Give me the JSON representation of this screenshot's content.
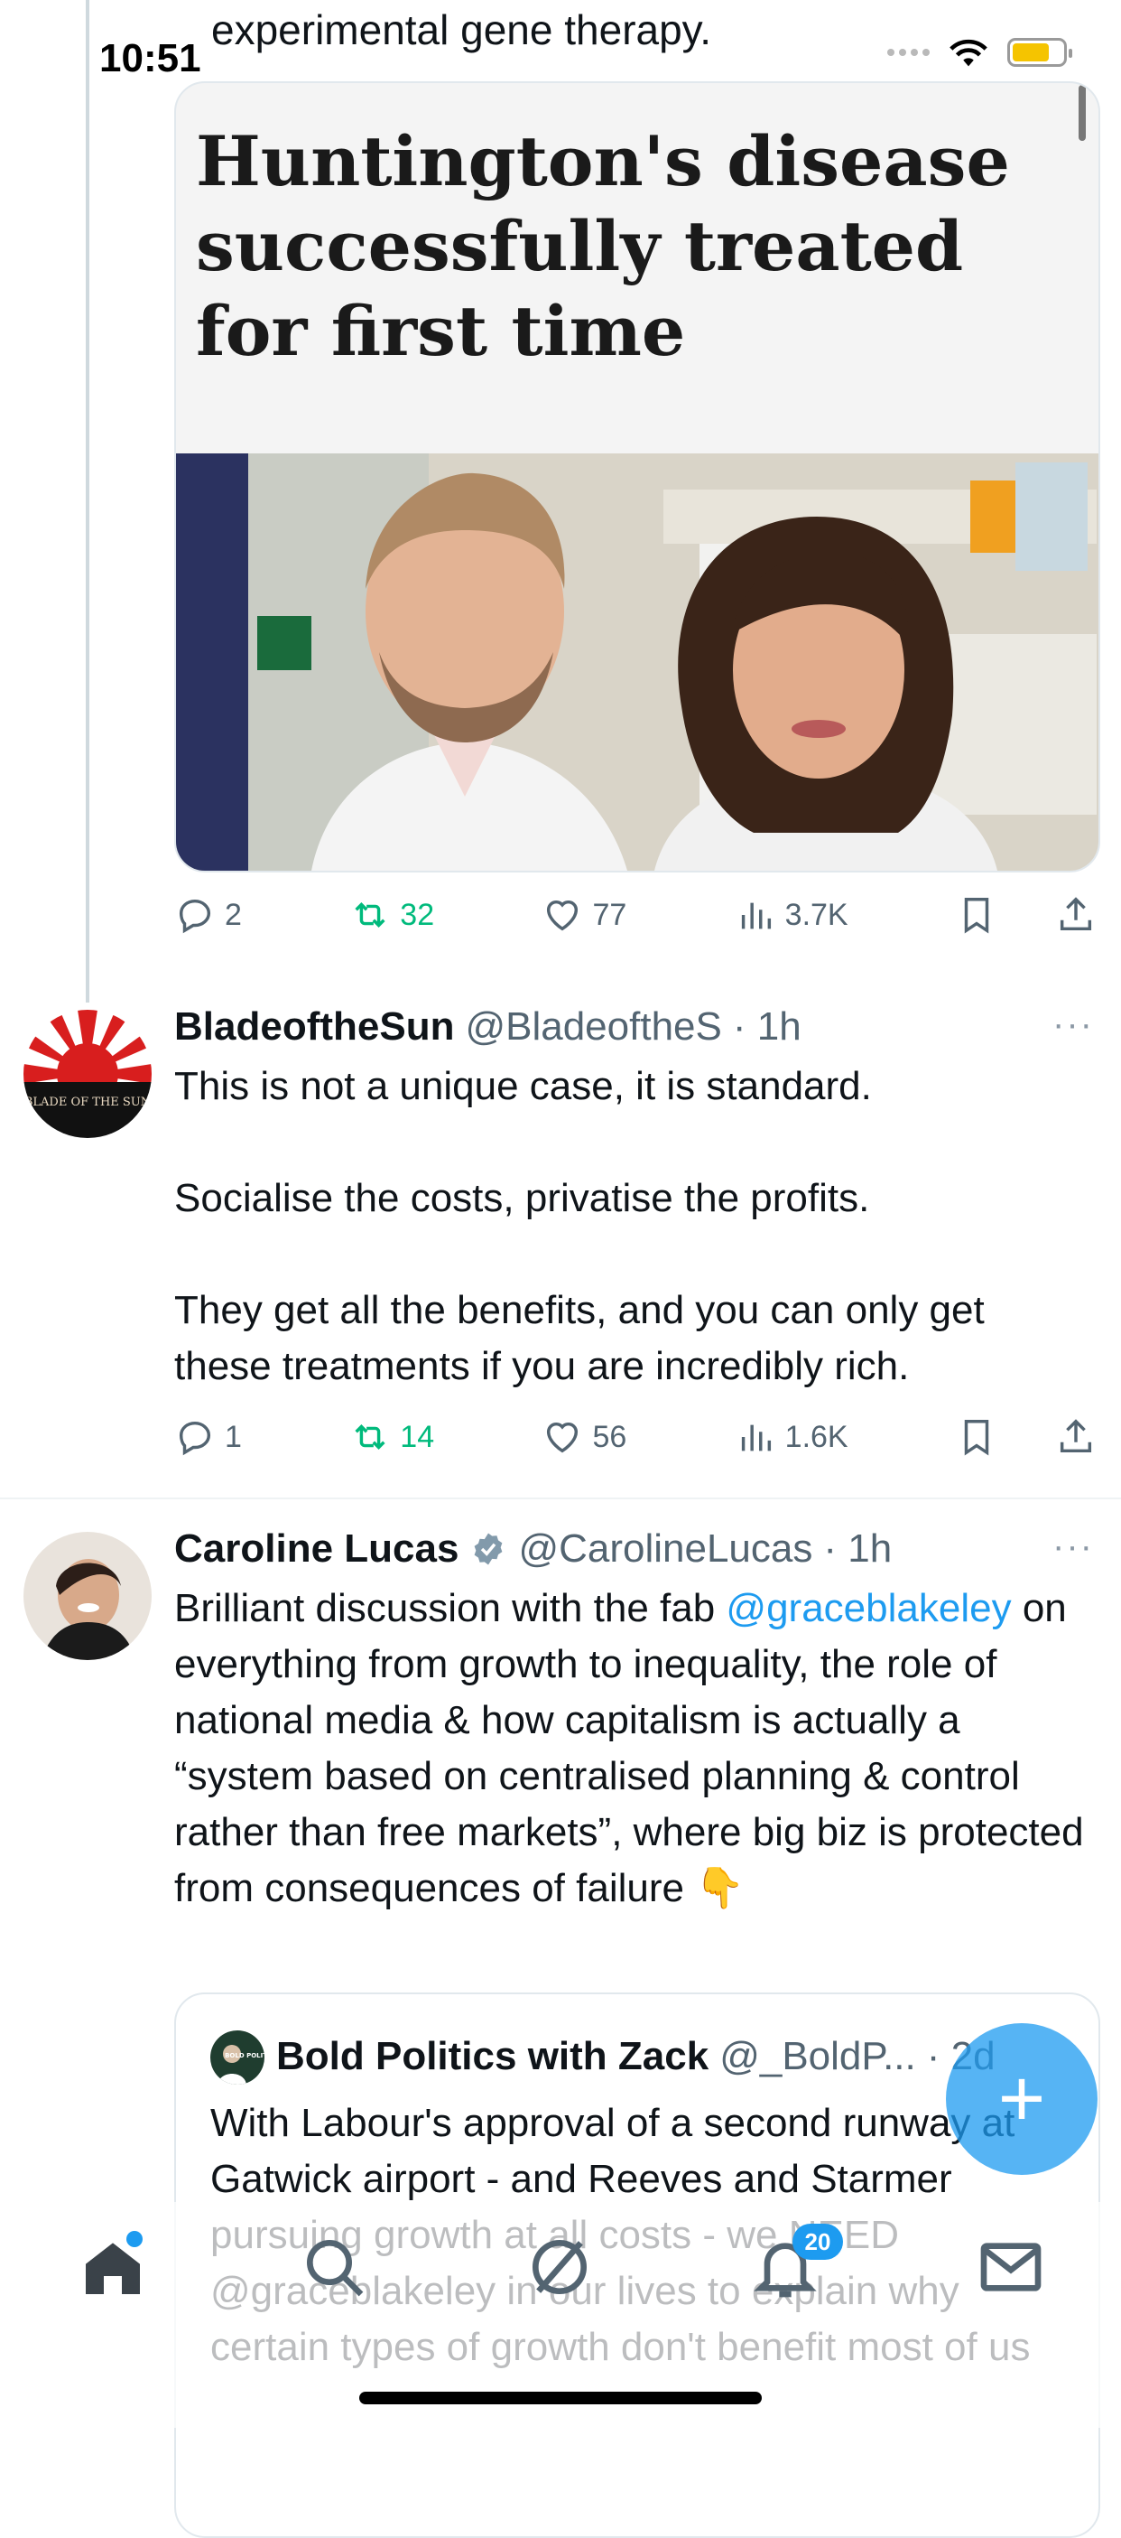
{
  "status_bar": {
    "time": "10:51"
  },
  "previous_tweet": {
    "trailing_text": "experimental gene therapy.",
    "card_headline": "Huntington's disease successfully treated for first time",
    "stats": {
      "replies": "2",
      "reposts": "32",
      "likes": "77",
      "views": "3.7K"
    }
  },
  "tweets": [
    {
      "name": "BladeoftheSun",
      "handle": "@BladeoftheS",
      "time": "· 1h",
      "avatar_text": "BLADE OF THE SUN",
      "paragraphs": [
        "This is not a unique case, it is standard.",
        "Socialise the costs, privatise the profits.",
        "They get all the benefits, and you can only get these treatments if you are incredibly rich."
      ],
      "stats": {
        "replies": "1",
        "reposts": "14",
        "likes": "56",
        "views": "1.6K"
      }
    },
    {
      "name": "Caroline Lucas",
      "handle": "@CarolineLucas",
      "time": "· 1h",
      "verified": true,
      "text_before": "Brilliant discussion with the fab",
      "mention": "@graceblakeley",
      "text_after": "on everything from growth to inequality, the role of national media & how capitalism is actually a “system based on centralised planning & control rather than free markets”, where big biz is protected from consequences of failure",
      "emoji": "👇",
      "quote": {
        "name": "Bold Politics with Zack",
        "handle": "@_BoldP...",
        "time": "· 2d",
        "avatar_text": "BOLD POLITICS",
        "text": "With Labour's approval of a second runway at Gatwick airport - and Reeves and Starmer pursuing growth at all costs - we NEED @graceblakeley in our lives to explain why certain types of growth don't benefit most of us"
      }
    }
  ],
  "more_label": "···",
  "fab_label": "+",
  "tabbar": {
    "items": [
      "home-icon",
      "search-icon",
      "grok-icon",
      "notifications-icon",
      "messages-icon"
    ],
    "notification_badge": "20"
  },
  "colors": {
    "accent": "#1d9bf0",
    "repost": "#00ba7c",
    "muted": "#536471"
  }
}
